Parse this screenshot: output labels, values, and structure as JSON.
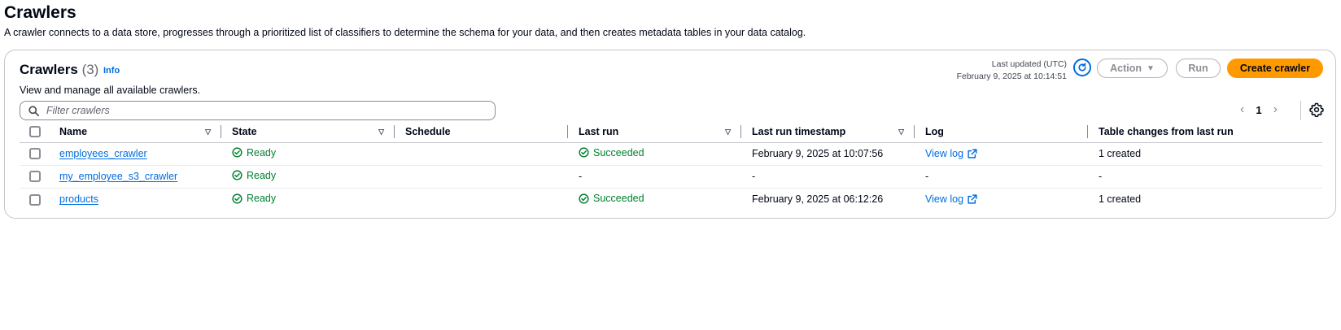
{
  "page": {
    "title": "Crawlers",
    "description": "A crawler connects to a data store, progresses through a prioritized list of classifiers to determine the schema for your data, and then creates metadata tables in your data catalog."
  },
  "panel": {
    "title": "Crawlers",
    "count": "(3)",
    "info": "Info",
    "subtitle": "View and manage all available crawlers.",
    "last_updated_label": "Last updated (UTC)",
    "last_updated_value": "February 9, 2025 at 10:14:51",
    "action_label": "Action",
    "run_label": "Run",
    "create_label": "Create crawler",
    "filter_placeholder": "Filter crawlers",
    "page_number": "1"
  },
  "table": {
    "headers": [
      "Name",
      "State",
      "Schedule",
      "Last run",
      "Last run timestamp",
      "Log",
      "Table changes from last run"
    ],
    "rows": [
      {
        "name": "employees_crawler",
        "state": "Ready",
        "schedule": "",
        "last_run": "Succeeded",
        "timestamp": "February 9, 2025 at 10:07:56",
        "log": "View log",
        "changes": "1 created"
      },
      {
        "name": "my_employee_s3_crawler",
        "state": "Ready",
        "schedule": "",
        "last_run": "-",
        "timestamp": "-",
        "log": "-",
        "changes": "-"
      },
      {
        "name": "products",
        "state": "Ready",
        "schedule": "",
        "last_run": "Succeeded",
        "timestamp": "February 9, 2025 at 06:12:26",
        "log": "View log",
        "changes": "1 created"
      }
    ]
  },
  "colors": {
    "accent": "#006ce0",
    "primary_button": "#ff9900",
    "success": "#00802f"
  },
  "icons": [
    "search-icon",
    "refresh-icon",
    "caret-down-icon",
    "chevron-left-icon",
    "chevron-right-icon",
    "gear-icon",
    "success-check-icon",
    "external-link-icon",
    "sort-icon"
  ]
}
